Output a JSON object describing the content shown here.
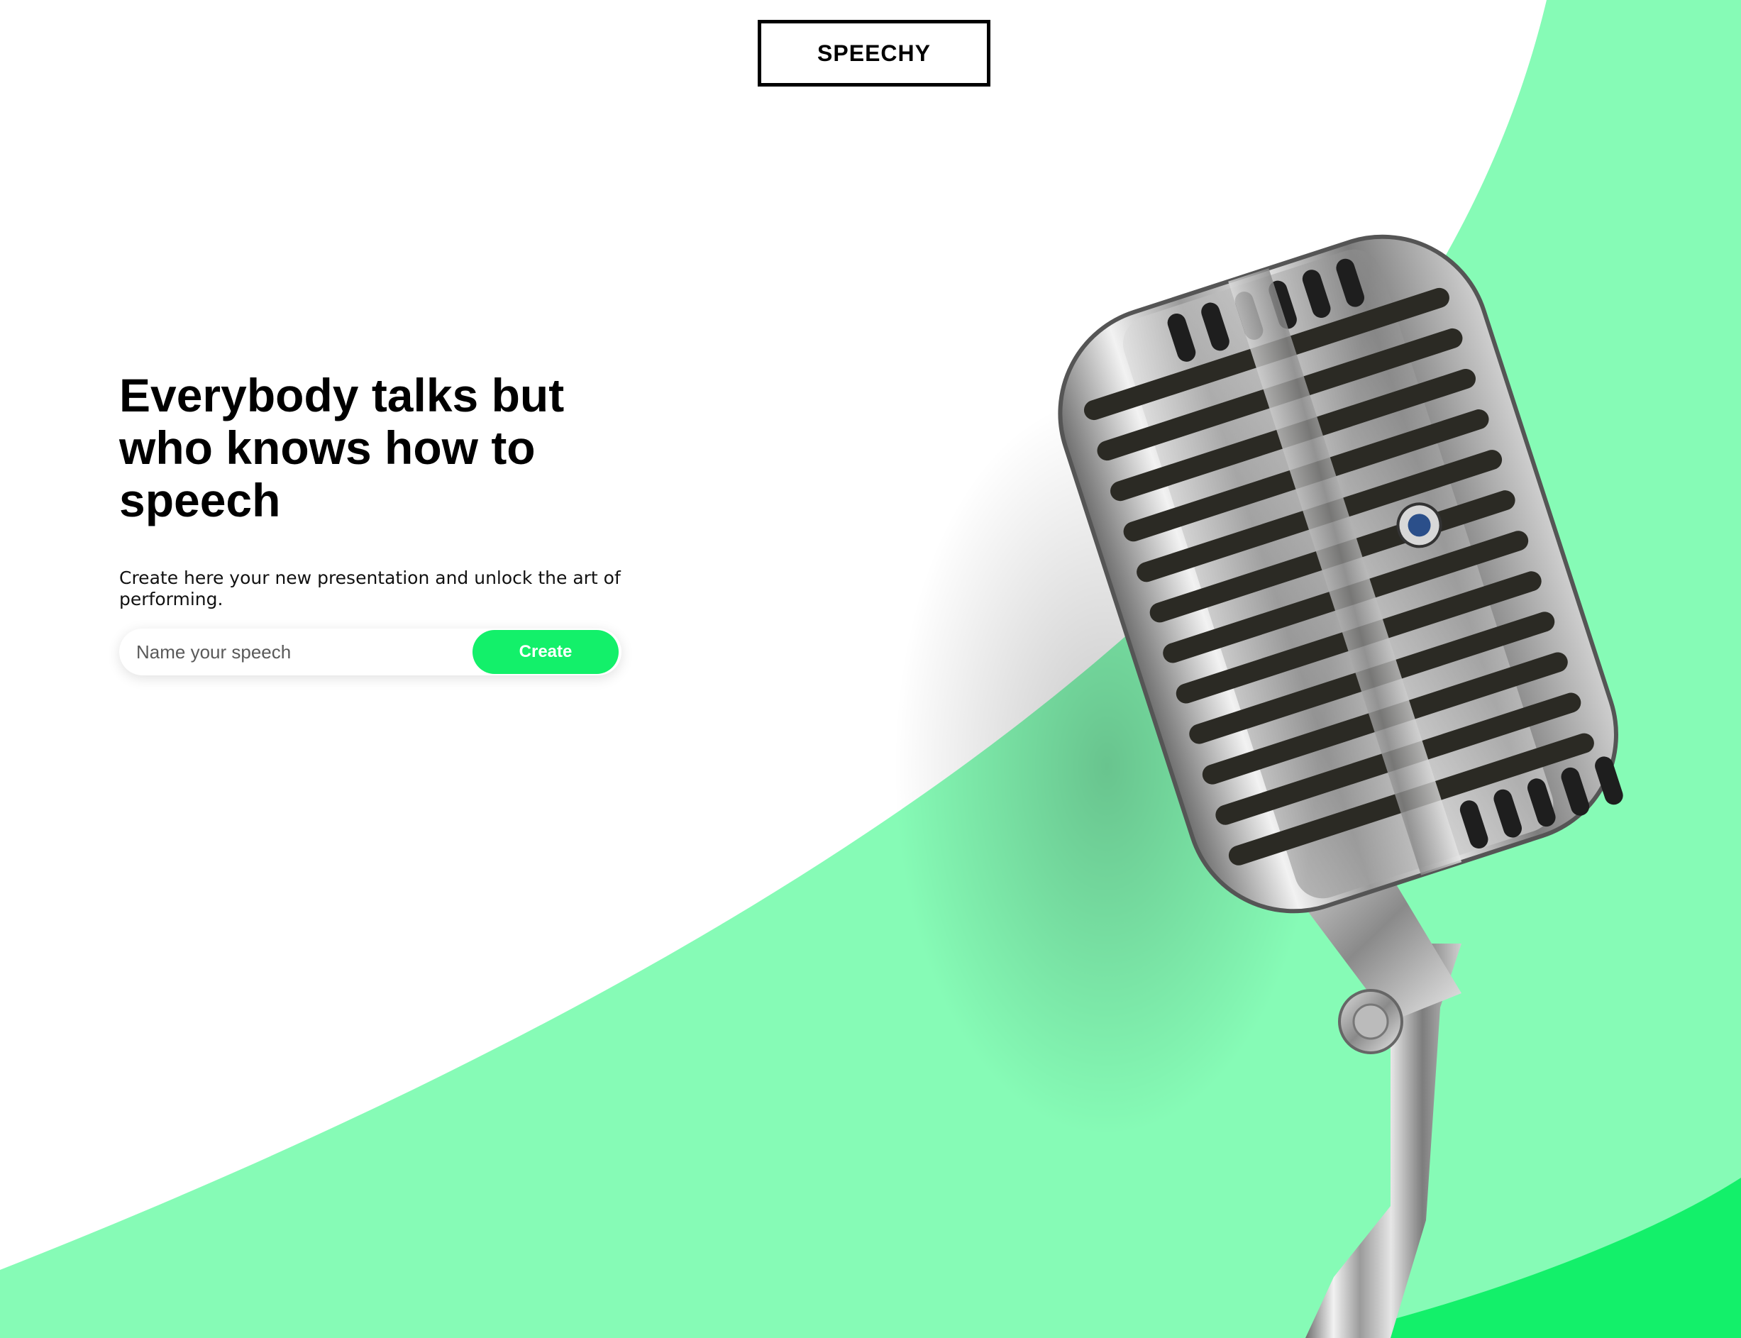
{
  "brand": {
    "logo_text": "SPEECHY"
  },
  "hero": {
    "headline": "Everybody talks but who knows how to speech",
    "subtext": "Create here your new presentation and unlock the art of performing."
  },
  "form": {
    "input_placeholder": "Name your speech",
    "input_value": "",
    "create_label": "Create"
  },
  "colors": {
    "accent_green": "#13f06a",
    "light_green": "#86fbb6",
    "text": "#000000",
    "background": "#ffffff"
  },
  "images": {
    "hero_image": "vintage-microphone"
  }
}
